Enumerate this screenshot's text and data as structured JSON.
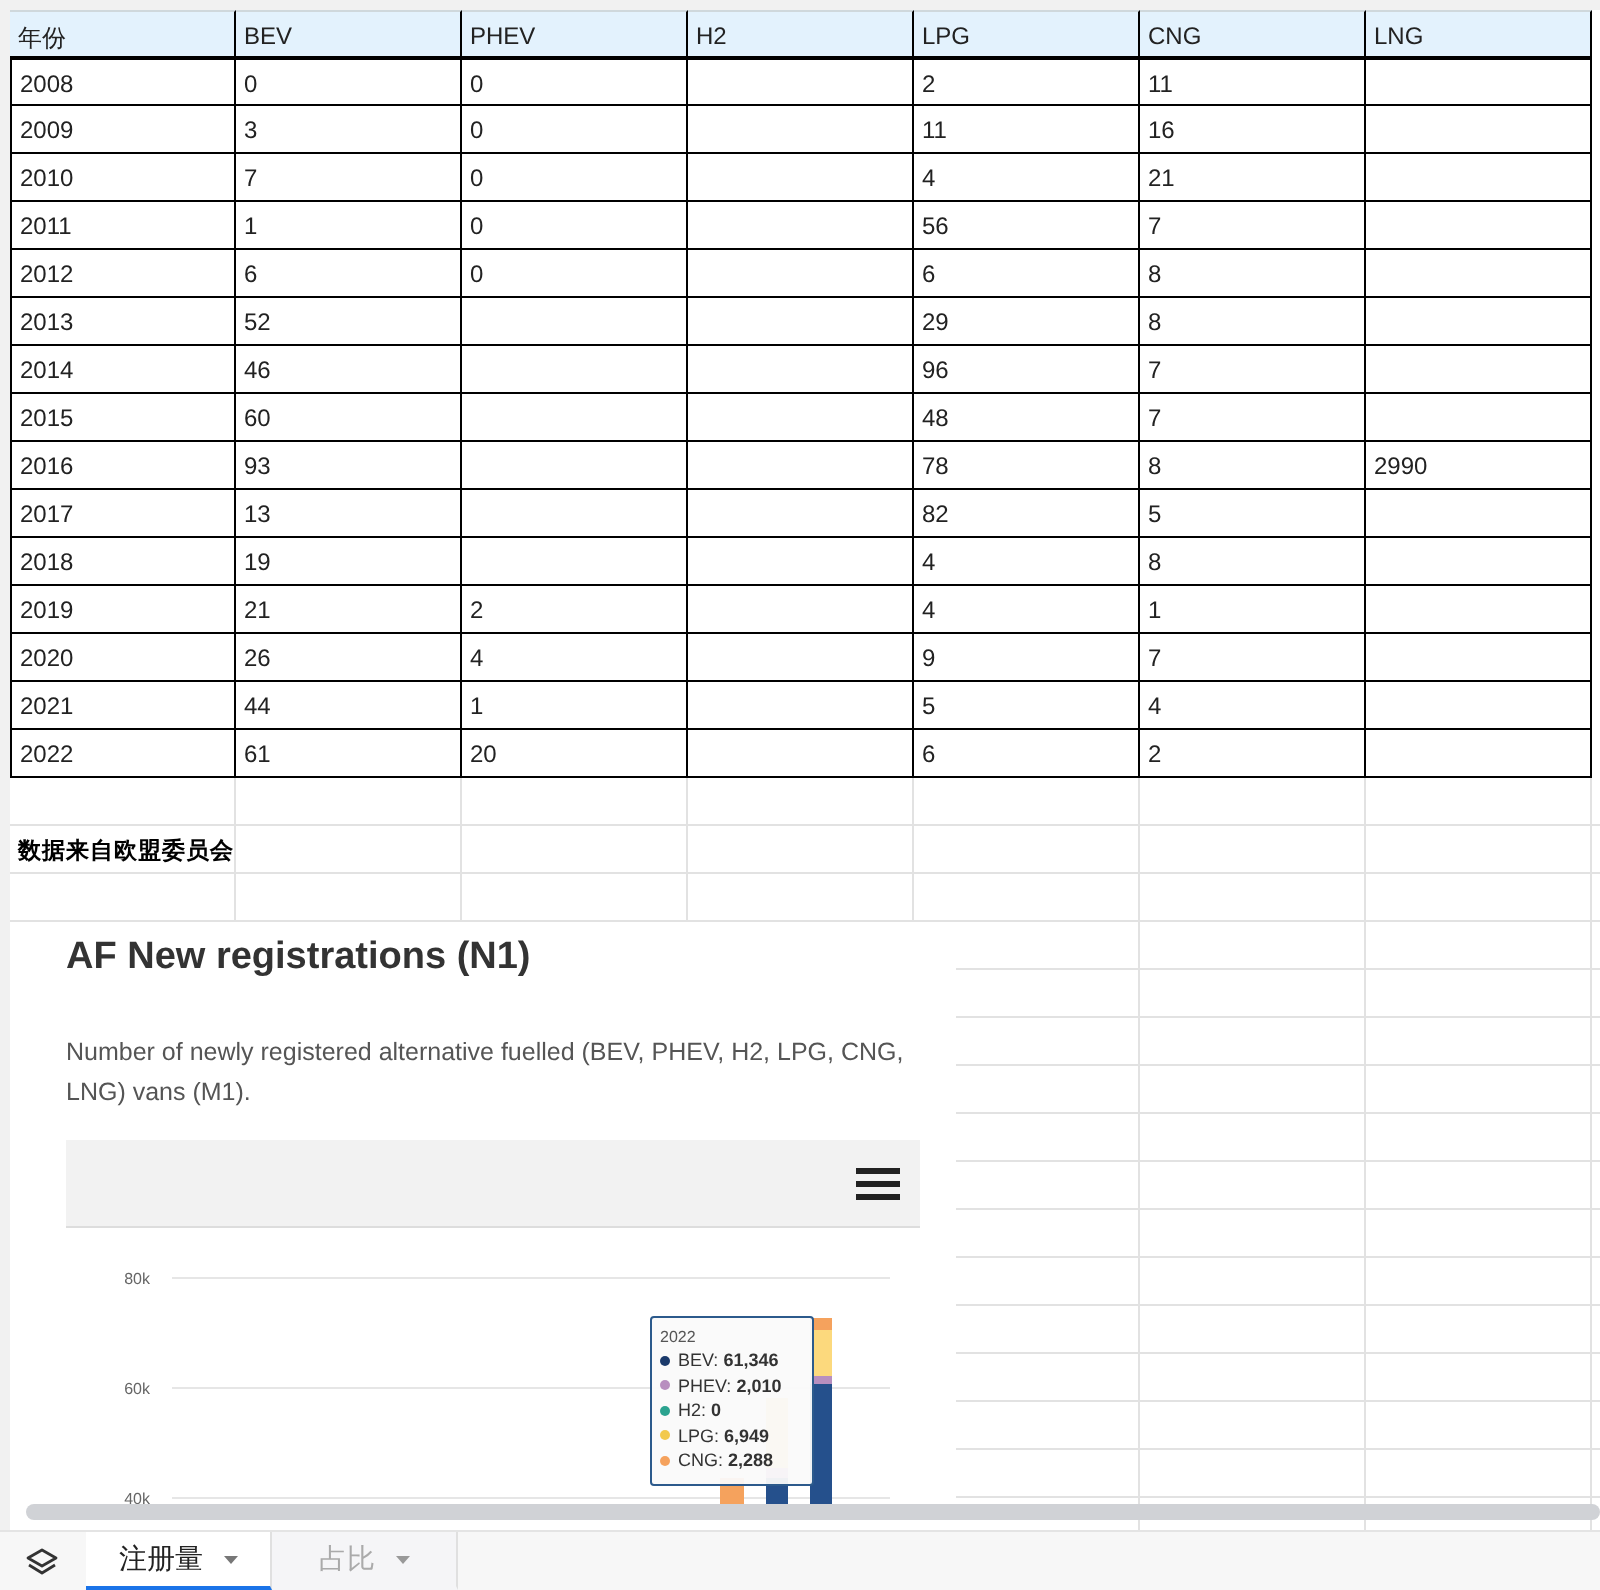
{
  "table": {
    "columns": [
      "年份",
      "BEV",
      "PHEV",
      "H2",
      "LPG",
      "CNG",
      "LNG"
    ],
    "rows": [
      {
        "cells": [
          "2008",
          "0",
          "0",
          "",
          "2",
          "11",
          ""
        ]
      },
      {
        "cells": [
          "2009",
          "3",
          "0",
          "",
          "11",
          "16",
          ""
        ]
      },
      {
        "cells": [
          "2010",
          "7",
          "0",
          "",
          "4",
          "21",
          ""
        ]
      },
      {
        "cells": [
          "2011",
          "1",
          "0",
          "",
          "56",
          "7",
          ""
        ]
      },
      {
        "cells": [
          "2012",
          "6",
          "0",
          "",
          "6",
          "8",
          ""
        ]
      },
      {
        "cells": [
          "2013",
          "52",
          "",
          "",
          "29",
          "8",
          ""
        ]
      },
      {
        "cells": [
          "2014",
          "46",
          "",
          "",
          "96",
          "7",
          ""
        ]
      },
      {
        "cells": [
          "2015",
          "60",
          "",
          "",
          "48",
          "7",
          ""
        ]
      },
      {
        "cells": [
          "2016",
          "93",
          "",
          "",
          "78",
          "8",
          "2990"
        ]
      },
      {
        "cells": [
          "2017",
          "13",
          "",
          "",
          "82",
          "5",
          ""
        ]
      },
      {
        "cells": [
          "2018",
          "19",
          "",
          "",
          "4",
          "8",
          ""
        ]
      },
      {
        "cells": [
          "2019",
          "21",
          "2",
          "",
          "4",
          "1",
          ""
        ]
      },
      {
        "cells": [
          "2020",
          "26",
          "4",
          "",
          "9",
          "7",
          ""
        ]
      },
      {
        "cells": [
          "2021",
          "44",
          "1",
          "",
          "5",
          "4",
          ""
        ]
      },
      {
        "cells": [
          "2022",
          "61",
          "20",
          "",
          "6",
          "2",
          ""
        ]
      }
    ]
  },
  "note": "数据来自欧盟委员会",
  "chart_panel": {
    "title": "AF New registrations (N1)",
    "description": "Number of newly registered alternative fuelled (BEV, PHEV, H2, LPG, CNG, LNG) vans (M1).",
    "axis_labels": [
      "80k",
      "60k",
      "40k"
    ],
    "tooltip": {
      "title": "2022",
      "items": [
        {
          "label": "BEV:",
          "value": "61,346",
          "color": "#1b3a6b"
        },
        {
          "label": "PHEV:",
          "value": "2,010",
          "color": "#b88fbf"
        },
        {
          "label": "H2:",
          "value": "0",
          "color": "#2ba38f"
        },
        {
          "label": "LPG:",
          "value": "6,949",
          "color": "#f2c94c"
        },
        {
          "label": "CNG:",
          "value": "2,288",
          "color": "#f5a25d"
        }
      ]
    }
  },
  "sheet_tabs": [
    {
      "label": "注册量",
      "selected": true
    },
    {
      "label": "占比",
      "selected": false
    }
  ]
}
